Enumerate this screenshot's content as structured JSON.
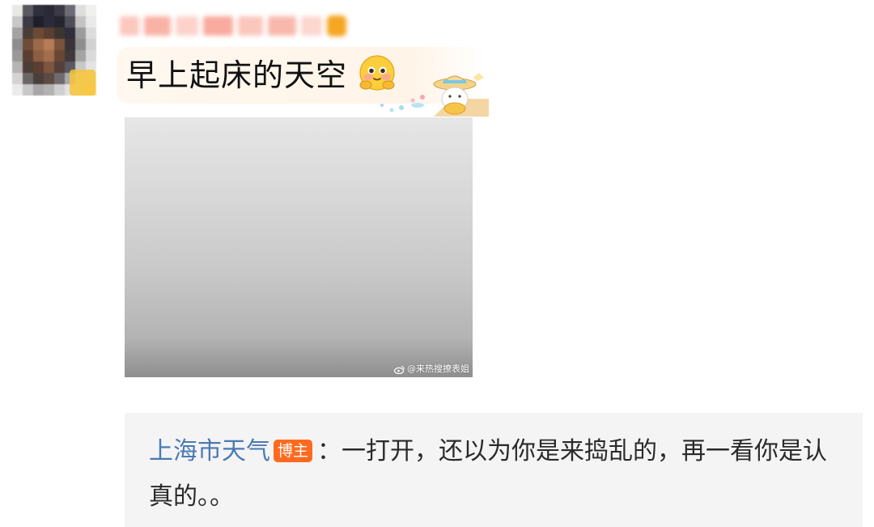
{
  "post": {
    "text": "早上起床的天空",
    "emoji_icon": "blushing-face-emoji",
    "sticker_icon": "bunny-straw-hat-sticker"
  },
  "photo": {
    "watermark": "@来热搜撩表姐",
    "watermark_icon": "weibo-logo-icon"
  },
  "reply": {
    "author": "上海市天气",
    "badge": "博主",
    "text": "：一打开，还以为你是来捣乱的，再一看你是认真的。。"
  },
  "colors": {
    "reply_author": "#4b7ab3",
    "badge_bg": "#ff6a1f",
    "reply_bg": "#f4f4f4"
  }
}
